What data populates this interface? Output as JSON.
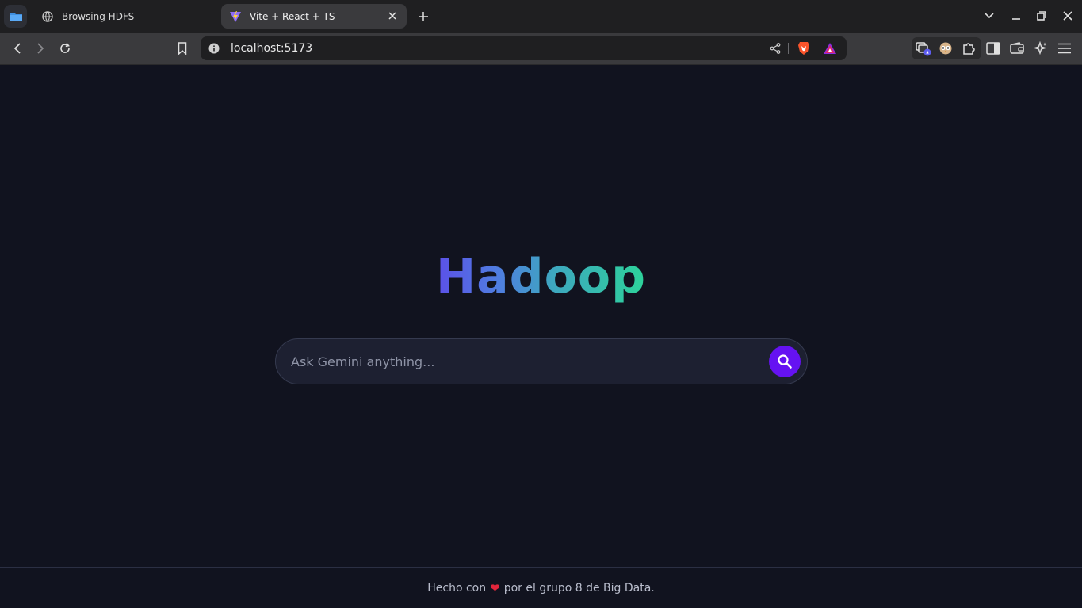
{
  "browser": {
    "tabs": [
      {
        "title": "Browsing HDFS",
        "icon": "globe-icon",
        "active": false
      },
      {
        "title": "Vite + React + TS",
        "icon": "vite-icon",
        "active": true
      }
    ],
    "url": "localhost:5173"
  },
  "page": {
    "title": "Hadoop",
    "search": {
      "placeholder": "Ask Gemini anything..."
    },
    "footer": {
      "prefix": "Hecho con",
      "heart": "❤",
      "suffix": "por el grupo 8 de Big Data."
    }
  },
  "colors": {
    "background": "#11131f",
    "accent": "#6512f2",
    "title_gradient": [
      "#5b50e8",
      "#4f7ee0",
      "#3ea6c0",
      "#2dd39a"
    ]
  }
}
